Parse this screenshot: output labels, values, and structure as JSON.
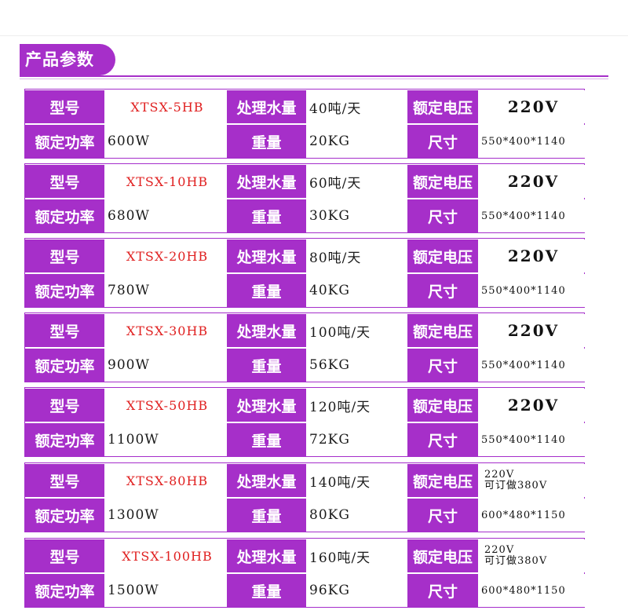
{
  "header": {
    "title": "产品参数"
  },
  "labels": {
    "model": "型号",
    "capacity": "处理水量",
    "voltage": "额定电压",
    "power": "额定功率",
    "weight": "重量",
    "size": "尺寸"
  },
  "products": [
    {
      "model": "XTSX-5HB",
      "capacity": "40吨/天",
      "voltage": "220V",
      "voltage_alt": "",
      "power": "600W",
      "weight": "20KG",
      "size": "550*400*1140"
    },
    {
      "model": "XTSX-10HB",
      "capacity": "60吨/天",
      "voltage": "220V",
      "voltage_alt": "",
      "power": "680W",
      "weight": "30KG",
      "size": "550*400*1140"
    },
    {
      "model": "XTSX-20HB",
      "capacity": "80吨/天",
      "voltage": "220V",
      "voltage_alt": "",
      "power": "780W",
      "weight": "40KG",
      "size": "550*400*1140"
    },
    {
      "model": "XTSX-30HB",
      "capacity": "100吨/天",
      "voltage": "220V",
      "voltage_alt": "",
      "power": "900W",
      "weight": "56KG",
      "size": "550*400*1140"
    },
    {
      "model": "XTSX-50HB",
      "capacity": "120吨/天",
      "voltage": "220V",
      "voltage_alt": "",
      "power": "1100W",
      "weight": "72KG",
      "size": "550*400*1140"
    },
    {
      "model": "XTSX-80HB",
      "capacity": "140吨/天",
      "voltage": "220V",
      "voltage_alt": "可订做380V",
      "power": "1300W",
      "weight": "80KG",
      "size": "600*480*1150"
    },
    {
      "model": "XTSX-100HB",
      "capacity": "160吨/天",
      "voltage": "220V",
      "voltage_alt": "可订做380V",
      "power": "1500W",
      "weight": "96KG",
      "size": "600*480*1150"
    }
  ],
  "colors": {
    "accent": "#a62fc9",
    "model_text": "#e02020"
  }
}
